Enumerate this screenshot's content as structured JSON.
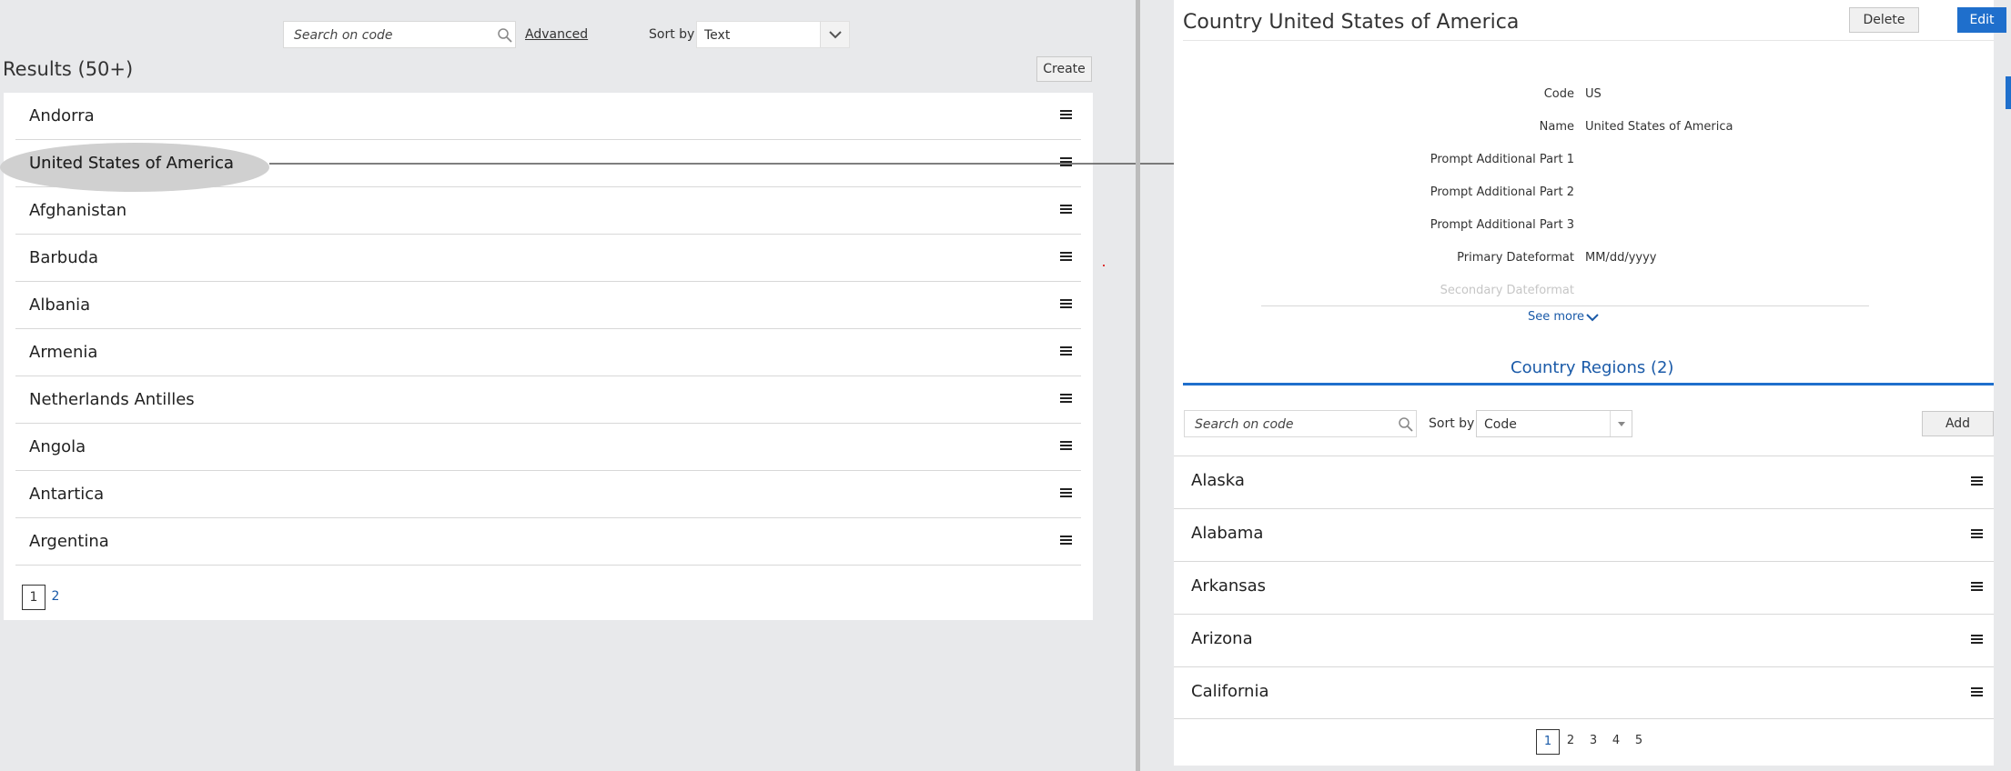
{
  "left": {
    "search": {
      "placeholder": "Search on code"
    },
    "advanced_label": "Advanced",
    "sort_label": "Sort by",
    "sort_value": "Text",
    "results_title": "Results (50+)",
    "create_label": "Create",
    "items": [
      {
        "label": "Andorra"
      },
      {
        "label": "United States of America"
      },
      {
        "label": "Afghanistan"
      },
      {
        "label": "Barbuda"
      },
      {
        "label": "Albania"
      },
      {
        "label": "Armenia"
      },
      {
        "label": "Netherlands Antilles"
      },
      {
        "label": "Angola"
      },
      {
        "label": "Antartica"
      },
      {
        "label": "Argentina"
      }
    ],
    "pages": [
      "1",
      "2"
    ]
  },
  "right": {
    "title": "Country United States of America",
    "delete_label": "Delete",
    "edit_label": "Edit",
    "fields": [
      {
        "label": "Code",
        "value": "US"
      },
      {
        "label": "Name",
        "value": "United States of America"
      },
      {
        "label": "Prompt Additional Part 1",
        "value": ""
      },
      {
        "label": "Prompt Additional Part 2",
        "value": ""
      },
      {
        "label": "Prompt Additional Part 3",
        "value": ""
      },
      {
        "label": "Primary Dateformat",
        "value": "MM/dd/yyyy"
      },
      {
        "label": "Secondary Dateformat",
        "value": ""
      }
    ],
    "see_more": "See more",
    "regions_title": "Country Regions (2)",
    "search": {
      "placeholder": "Search on code"
    },
    "sort_label": "Sort by",
    "sort_value": "Code",
    "add_label": "Add",
    "regions": [
      {
        "label": "Alaska"
      },
      {
        "label": "Alabama"
      },
      {
        "label": "Arkansas"
      },
      {
        "label": "Arizona"
      },
      {
        "label": "California"
      }
    ],
    "pages": [
      "1",
      "2",
      "3",
      "4",
      "5"
    ]
  },
  "colors": {
    "accent": "#1f6fcc",
    "link": "#1a5aa8",
    "background": "#e8e9eb"
  }
}
